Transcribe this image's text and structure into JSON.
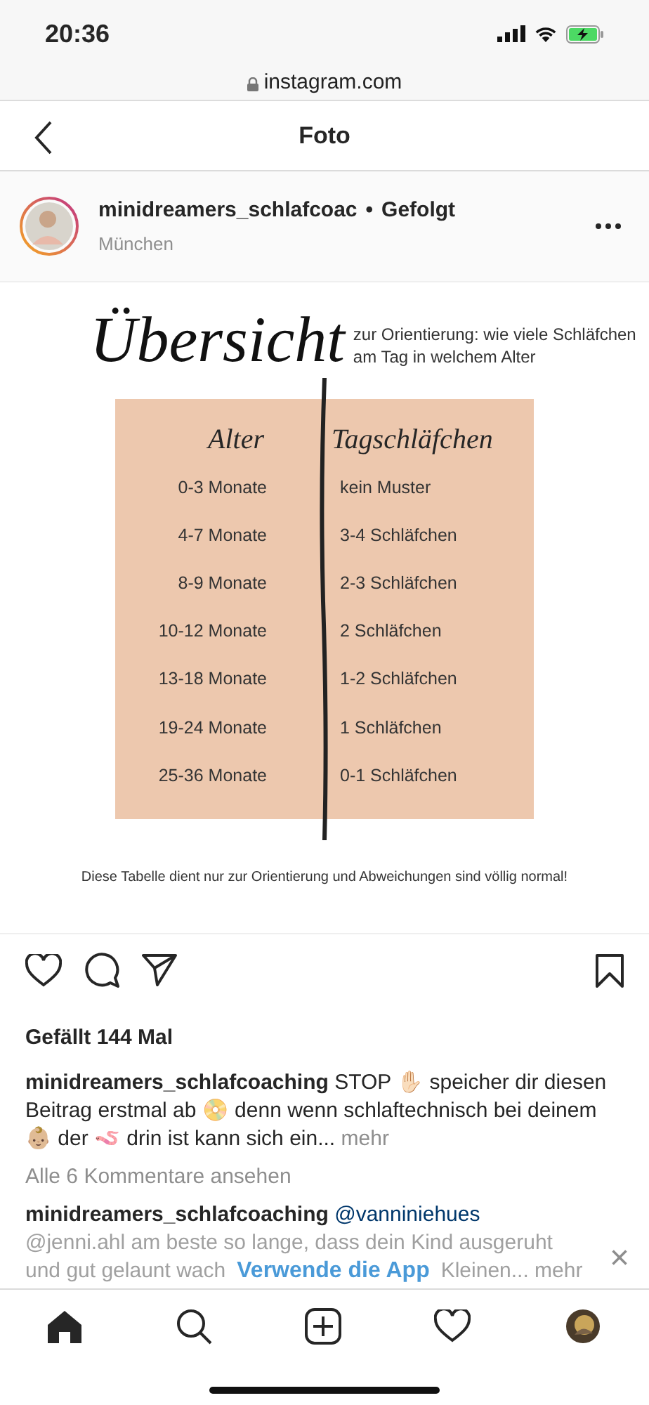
{
  "status_bar": {
    "time": "20:36"
  },
  "browser": {
    "url": "instagram.com"
  },
  "header": {
    "title": "Foto"
  },
  "post": {
    "username": "minidreamers_schlafcoac",
    "separator": "•",
    "follow": "Gefolgt",
    "location": "München"
  },
  "image": {
    "title": "Übersicht",
    "subtitle": "zur Orientierung: wie viele Schläfchen am Tag in welchem Alter",
    "columns": [
      "Alter",
      "Tagschläfchen"
    ],
    "rows": [
      [
        "0-3 Monate",
        "kein Muster"
      ],
      [
        "4-7 Monate",
        "3-4 Schläfchen"
      ],
      [
        "8-9 Monate",
        "2-3 Schläfchen"
      ],
      [
        "10-12 Monate",
        "2 Schläfchen"
      ],
      [
        "13-18 Monate",
        "1-2 Schläfchen"
      ],
      [
        "19-24 Monate",
        "1 Schläfchen"
      ],
      [
        "25-36 Monate",
        "0-1 Schläfchen"
      ]
    ],
    "note": "Diese Tabelle dient nur zur Orientierung und Abweichungen sind völlig normal!"
  },
  "likes": "Gefällt 144 Mal",
  "caption": {
    "username": "minidreamers_schlafcoaching",
    "text": "STOP ✋🏻 speicher dir diesen Beitrag erstmal ab 📀 denn wenn schlaftechnisch bei deinem 👶🏼 der 🪱 drin ist kann sich ein...",
    "more": "mehr"
  },
  "view_comments": "Alle 6 Kommentare ansehen",
  "comment": {
    "username": "minidreamers_schlafcoaching",
    "mention": "@vanniniehues",
    "line_2": "@jenni.ahl am beste so lange, dass dein Kind ausgeruht",
    "line_3_start": "und gut gelaunt wach",
    "line_3_end": "Kleinen... mehr"
  },
  "app_banner": {
    "label": "Verwende die App",
    "close": "×"
  },
  "tab_bar": [
    {
      "kind": "home",
      "selected": true
    },
    {
      "kind": "search",
      "selected": false
    },
    {
      "kind": "add",
      "selected": false
    },
    {
      "kind": "activity",
      "selected": false
    },
    {
      "kind": "profile",
      "selected": false
    }
  ]
}
